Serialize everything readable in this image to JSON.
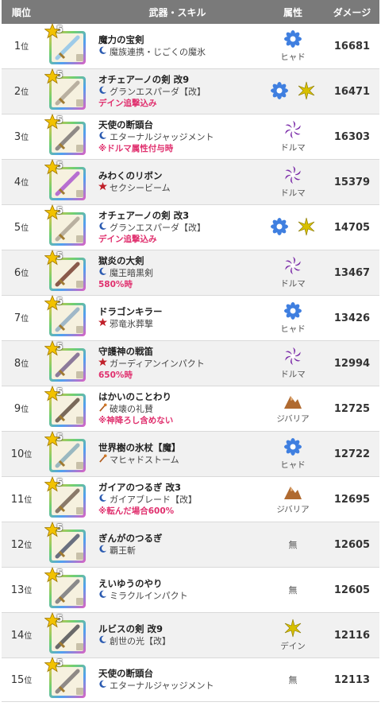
{
  "header": {
    "rank": "順位",
    "weapon_skill": "武器・スキル",
    "attribute": "属性",
    "damage": "ダメージ"
  },
  "rank_suffix": "位",
  "rows": [
    {
      "rank": "1",
      "weapon": "魔力の宝剣",
      "skill": "魔族連携・じごくの魔氷",
      "skill_icon": "crescent",
      "note": "",
      "attr": [
        "hyado"
      ],
      "attr_label": "ヒャド",
      "damage": "16681",
      "stars": "5",
      "blade": "#9ecbe8"
    },
    {
      "rank": "2",
      "weapon": "オチェアーノの剣 改9",
      "skill": "グランエスパーダ【改】",
      "skill_icon": "crescent",
      "note": "デイン追撃込み",
      "attr": [
        "hyado",
        "dein"
      ],
      "attr_label": "",
      "damage": "16471",
      "stars": "5",
      "blade": "#b9b0a0"
    },
    {
      "rank": "3",
      "weapon": "天使の断頭台",
      "skill": "エターナルジャッジメント",
      "skill_icon": "crescent",
      "note": "※ドルマ属性付与時",
      "attr": [
        "doruma"
      ],
      "attr_label": "ドルマ",
      "damage": "16303",
      "stars": "5",
      "blade": "#8f8a86"
    },
    {
      "rank": "4",
      "weapon": "みわくのリボン",
      "skill": "セクシービーム",
      "skill_icon": "burst",
      "note": "",
      "attr": [
        "doruma"
      ],
      "attr_label": "ドルマ",
      "damage": "15379",
      "stars": "5",
      "blade": "#b76fd0"
    },
    {
      "rank": "5",
      "weapon": "オチェアーノの剣 改3",
      "skill": "グランエスパーダ【改】",
      "skill_icon": "crescent",
      "note": "デイン追撃込み",
      "attr": [
        "hyado",
        "dein"
      ],
      "attr_label": "",
      "damage": "14705",
      "stars": "5",
      "blade": "#b9b0a0"
    },
    {
      "rank": "6",
      "weapon": "獄炎の大剣",
      "skill": "魔王暗黒剣",
      "skill_icon": "crescent",
      "note": "580%時",
      "attr": [
        "doruma"
      ],
      "attr_label": "ドルマ",
      "damage": "13467",
      "stars": "5",
      "blade": "#8a5a4a"
    },
    {
      "rank": "7",
      "weapon": "ドラゴンキラー",
      "skill": "邪竜氷葬撃",
      "skill_icon": "burst",
      "note": "",
      "attr": [
        "hyado"
      ],
      "attr_label": "ヒャド",
      "damage": "13426",
      "stars": "5",
      "blade": "#a0b8c8"
    },
    {
      "rank": "8",
      "weapon": "守護神の戦笛",
      "skill": "ガーディアンインパクト",
      "skill_icon": "burst",
      "note": "650%時",
      "attr": [
        "doruma"
      ],
      "attr_label": "ドルマ",
      "damage": "12994",
      "stars": "5",
      "blade": "#8c7a9a"
    },
    {
      "rank": "9",
      "weapon": "はかいのことわり",
      "skill": "破壊の礼賛",
      "skill_icon": "staff",
      "note": "※神降ろし含めない",
      "attr": [
        "jibaria"
      ],
      "attr_label": "ジバリア",
      "damage": "12725",
      "stars": "5",
      "blade": "#7a6a5a"
    },
    {
      "rank": "10",
      "weapon": "世界樹の氷杖【魔】",
      "skill": "マヒャドストーム",
      "skill_icon": "staff",
      "note": "",
      "attr": [
        "hyado"
      ],
      "attr_label": "ヒャド",
      "damage": "12722",
      "stars": "5",
      "blade": "#9ab8c0"
    },
    {
      "rank": "11",
      "weapon": "ガイアのつるぎ 改3",
      "skill": "ガイアブレード【改】",
      "skill_icon": "crescent",
      "note": "※転んだ場合600%",
      "attr": [
        "jibaria"
      ],
      "attr_label": "ジバリア",
      "damage": "12695",
      "stars": "5",
      "blade": "#8a7a6a"
    },
    {
      "rank": "12",
      "weapon": "ぎんがのつるぎ",
      "skill": "覇王斬",
      "skill_icon": "crescent",
      "note": "",
      "attr": [],
      "attr_label": "無",
      "damage": "12605",
      "stars": "5",
      "blade": "#6a7080"
    },
    {
      "rank": "13",
      "weapon": "えいゆうのやり",
      "skill": "ミラクルインパクト",
      "skill_icon": "crescent",
      "note": "",
      "attr": [],
      "attr_label": "無",
      "damage": "12605",
      "stars": "5",
      "blade": "#8a8a8a"
    },
    {
      "rank": "14",
      "weapon": "ルビスの剣 改9",
      "skill": "創世の光【改】",
      "skill_icon": "crescent",
      "note": "",
      "attr": [
        "dein"
      ],
      "attr_label": "デイン",
      "damage": "12116",
      "stars": "5",
      "blade": "#6a6a6a"
    },
    {
      "rank": "15",
      "weapon": "天使の断頭台",
      "skill": "エターナルジャッジメント",
      "skill_icon": "crescent",
      "note": "",
      "attr": [],
      "attr_label": "無",
      "damage": "12113",
      "stars": "5",
      "blade": "#8f8a86"
    }
  ],
  "colors": {
    "header_bg": "#7a7a7a",
    "note": "#e0306e",
    "hyado": "#3f7fe0",
    "doruma": "#7a2aa8",
    "dein": "#d8c000",
    "jibaria": "#b06a30"
  },
  "icons": {
    "crescent": "crescent-skill-icon",
    "burst": "burst-skill-icon",
    "staff": "staff-skill-icon"
  }
}
